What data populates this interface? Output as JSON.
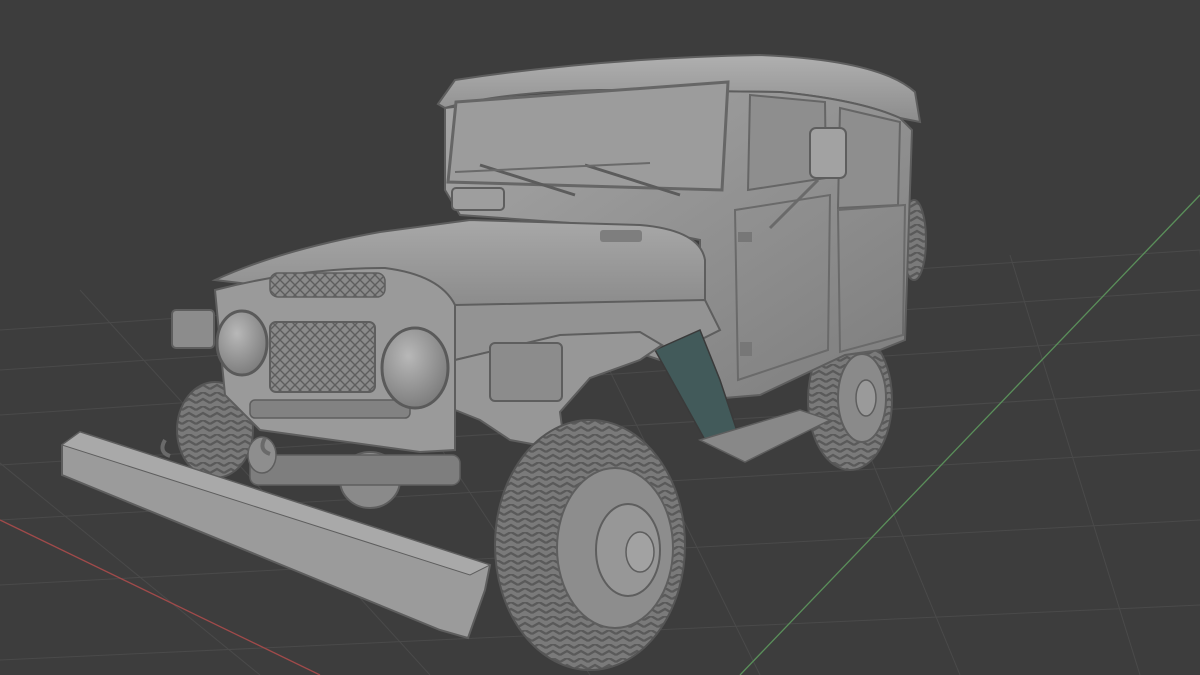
{
  "viewport": {
    "mode": "solid-shading",
    "background_color": "#3d3d3d",
    "grid_color": "#4a4a4a",
    "x_axis_color": "#a04a4a",
    "y_axis_color": "#5a8f5a",
    "model_color": "#8f8f8f",
    "visible_text": ""
  },
  "model": {
    "name": "",
    "shape_kind": "4x4-utility-vehicle"
  }
}
